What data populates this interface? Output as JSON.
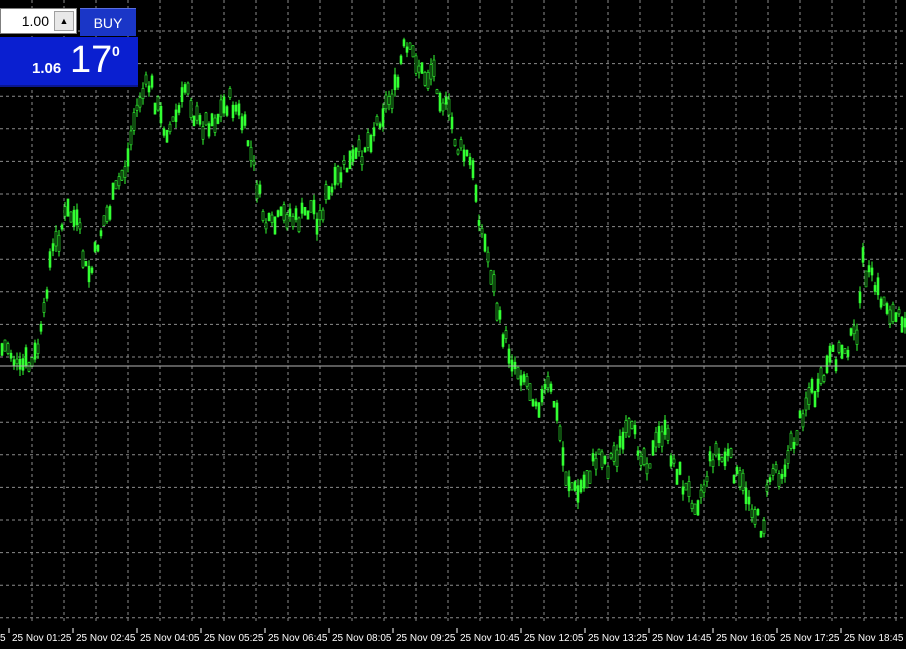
{
  "trade_panel": {
    "lot_value": "1.00",
    "spinner_up": "▲",
    "buy_label": "BUY",
    "price_small": "1.06",
    "price_big": "17",
    "price_sup": "0"
  },
  "colors": {
    "background": "#000000",
    "grid": "#8c8c8c",
    "candle": "#33ff33",
    "price_line": "#b4b4b4",
    "buy_blue": "#0a1fd0"
  },
  "time_axis": {
    "labels": [
      "25 Nov 01:25",
      "25 Nov 02:45",
      "25 Nov 04:05",
      "25 Nov 05:25",
      "25 Nov 06:45",
      "25 Nov 08:05",
      "25 Nov 09:25",
      "25 Nov 10:45",
      "25 Nov 12:05",
      "25 Nov 13:25",
      "25 Nov 14:45",
      "25 Nov 16:05",
      "25 Nov 17:25",
      "25 Nov 18:45"
    ],
    "leading_fragment": "5"
  },
  "chart_data": {
    "type": "line",
    "title": "",
    "xlabel": "",
    "ylabel": "",
    "series_shape": [
      [
        0,
        0.57
      ],
      [
        6,
        0.56
      ],
      [
        12,
        0.58
      ],
      [
        18,
        0.61
      ],
      [
        24,
        0.59
      ],
      [
        30,
        0.6
      ],
      [
        36,
        0.57
      ],
      [
        42,
        0.53
      ],
      [
        48,
        0.42
      ],
      [
        54,
        0.39
      ],
      [
        60,
        0.36
      ],
      [
        66,
        0.33
      ],
      [
        72,
        0.34
      ],
      [
        78,
        0.36
      ],
      [
        84,
        0.43
      ],
      [
        90,
        0.44
      ],
      [
        96,
        0.39
      ],
      [
        102,
        0.35
      ],
      [
        108,
        0.33
      ],
      [
        114,
        0.3
      ],
      [
        120,
        0.27
      ],
      [
        126,
        0.25
      ],
      [
        132,
        0.18
      ],
      [
        138,
        0.14
      ],
      [
        144,
        0.12
      ],
      [
        150,
        0.11
      ],
      [
        156,
        0.15
      ],
      [
        162,
        0.18
      ],
      [
        168,
        0.19
      ],
      [
        174,
        0.17
      ],
      [
        180,
        0.15
      ],
      [
        186,
        0.1
      ],
      [
        192,
        0.16
      ],
      [
        198,
        0.18
      ],
      [
        204,
        0.18
      ],
      [
        210,
        0.17
      ],
      [
        216,
        0.17
      ],
      [
        222,
        0.15
      ],
      [
        228,
        0.14
      ],
      [
        234,
        0.15
      ],
      [
        240,
        0.17
      ],
      [
        246,
        0.2
      ],
      [
        252,
        0.25
      ],
      [
        258,
        0.3
      ],
      [
        264,
        0.35
      ],
      [
        270,
        0.36
      ],
      [
        276,
        0.35
      ],
      [
        282,
        0.34
      ],
      [
        288,
        0.33
      ],
      [
        294,
        0.35
      ],
      [
        300,
        0.34
      ],
      [
        306,
        0.33
      ],
      [
        312,
        0.32
      ],
      [
        318,
        0.35
      ],
      [
        324,
        0.31
      ],
      [
        330,
        0.3
      ],
      [
        336,
        0.28
      ],
      [
        342,
        0.26
      ],
      [
        348,
        0.25
      ],
      [
        354,
        0.24
      ],
      [
        360,
        0.23
      ],
      [
        366,
        0.21
      ],
      [
        372,
        0.19
      ],
      [
        378,
        0.17
      ],
      [
        384,
        0.15
      ],
      [
        390,
        0.13
      ],
      [
        396,
        0.12
      ],
      [
        402,
        0.05
      ],
      [
        408,
        0.06
      ],
      [
        414,
        0.06
      ],
      [
        420,
        0.09
      ],
      [
        426,
        0.1
      ],
      [
        432,
        0.08
      ],
      [
        438,
        0.12
      ],
      [
        444,
        0.15
      ],
      [
        450,
        0.17
      ],
      [
        456,
        0.22
      ],
      [
        462,
        0.23
      ],
      [
        468,
        0.24
      ],
      [
        474,
        0.28
      ],
      [
        480,
        0.36
      ],
      [
        486,
        0.4
      ],
      [
        492,
        0.45
      ],
      [
        498,
        0.52
      ],
      [
        504,
        0.55
      ],
      [
        510,
        0.58
      ],
      [
        516,
        0.6
      ],
      [
        522,
        0.61
      ],
      [
        528,
        0.63
      ],
      [
        534,
        0.65
      ],
      [
        540,
        0.66
      ],
      [
        546,
        0.63
      ],
      [
        552,
        0.65
      ],
      [
        558,
        0.7
      ],
      [
        564,
        0.78
      ],
      [
        570,
        0.8
      ],
      [
        576,
        0.82
      ],
      [
        582,
        0.8
      ],
      [
        588,
        0.78
      ],
      [
        594,
        0.76
      ],
      [
        600,
        0.74
      ],
      [
        606,
        0.77
      ],
      [
        612,
        0.75
      ],
      [
        618,
        0.74
      ],
      [
        624,
        0.72
      ],
      [
        630,
        0.71
      ],
      [
        636,
        0.73
      ],
      [
        642,
        0.75
      ],
      [
        648,
        0.76
      ],
      [
        654,
        0.74
      ],
      [
        660,
        0.71
      ],
      [
        666,
        0.72
      ],
      [
        672,
        0.76
      ],
      [
        678,
        0.78
      ],
      [
        684,
        0.81
      ],
      [
        690,
        0.82
      ],
      [
        696,
        0.83
      ],
      [
        702,
        0.81
      ],
      [
        708,
        0.77
      ],
      [
        714,
        0.74
      ],
      [
        720,
        0.76
      ],
      [
        726,
        0.75
      ],
      [
        732,
        0.77
      ],
      [
        738,
        0.8
      ],
      [
        744,
        0.81
      ],
      [
        750,
        0.83
      ],
      [
        756,
        0.86
      ],
      [
        762,
        0.88
      ],
      [
        768,
        0.79
      ],
      [
        774,
        0.77
      ],
      [
        780,
        0.78
      ],
      [
        786,
        0.76
      ],
      [
        792,
        0.73
      ],
      [
        798,
        0.7
      ],
      [
        804,
        0.66
      ],
      [
        810,
        0.64
      ],
      [
        816,
        0.65
      ],
      [
        822,
        0.62
      ],
      [
        828,
        0.59
      ],
      [
        834,
        0.58
      ],
      [
        840,
        0.57
      ],
      [
        846,
        0.56
      ],
      [
        852,
        0.55
      ],
      [
        858,
        0.52
      ],
      [
        862,
        0.42
      ],
      [
        868,
        0.44
      ],
      [
        874,
        0.46
      ],
      [
        880,
        0.48
      ],
      [
        886,
        0.49
      ],
      [
        892,
        0.51
      ],
      [
        898,
        0.52
      ],
      [
        906,
        0.5
      ]
    ]
  }
}
